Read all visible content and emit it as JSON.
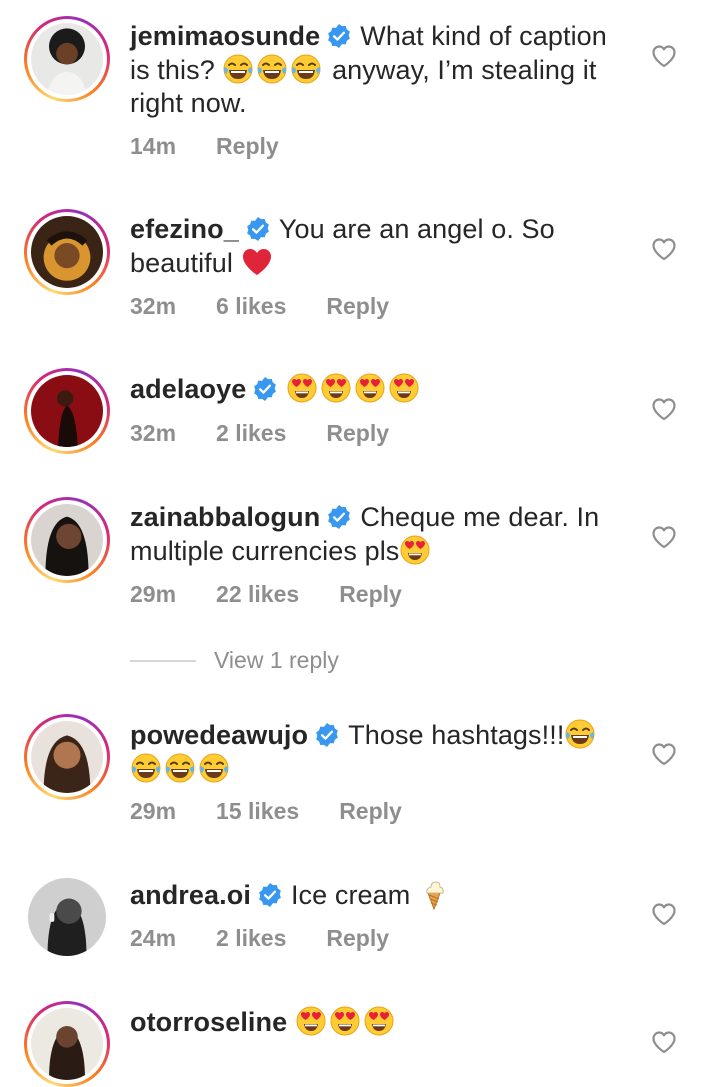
{
  "comments": [
    {
      "username": "jemimaosunde",
      "verified": true,
      "text_before": "What kind of caption",
      "line2_a": "is this?",
      "line2_b": "anyway, I’m stealing it",
      "line3": "right now.",
      "time": "14m",
      "likes": "",
      "reply": "Reply"
    },
    {
      "username": "efezino_",
      "verified": true,
      "text_before": "You are an angel o. So",
      "line2": "beautiful",
      "time": "32m",
      "likes": "6 likes",
      "reply": "Reply"
    },
    {
      "username": "adelaoye",
      "verified": true,
      "time": "32m",
      "likes": "2 likes",
      "reply": "Reply"
    },
    {
      "username": "zainabbalogun",
      "verified": true,
      "text_before": "Cheque me dear. In",
      "line2": "multiple currencies pls",
      "time": "29m",
      "likes": "22 likes",
      "reply": "Reply"
    },
    {
      "username": "powedeawujo",
      "verified": true,
      "text_before": "Those hashtags!!!",
      "time": "29m",
      "likes": "15 likes",
      "reply": "Reply"
    },
    {
      "username": "andrea.oi",
      "verified": true,
      "text_before": "Ice cream",
      "time": "24m",
      "likes": "2 likes",
      "reply": "Reply"
    },
    {
      "username": "otorroseline",
      "verified": false
    }
  ],
  "view_replies": "View 1 reply",
  "icons": {
    "verified": "verified-badge-icon",
    "like": "heart-outline-icon",
    "laugh": "face-with-tears-of-joy-icon",
    "heart_eyes": "smiling-face-with-heart-eyes-icon",
    "red_heart": "red-heart-icon",
    "ice_cream": "soft-ice-cream-icon"
  },
  "colors": {
    "verified": "#3897f0",
    "meta": "#8e8e8e",
    "text": "#262626"
  }
}
